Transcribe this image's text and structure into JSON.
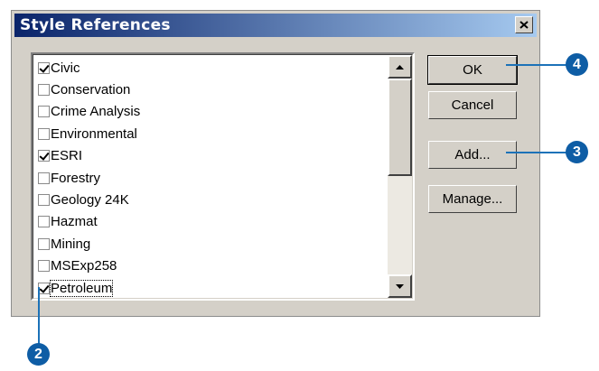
{
  "dialog": {
    "title": "Style References",
    "close_icon": "close-icon"
  },
  "style_list": {
    "items": [
      {
        "label": "Civic",
        "checked": true
      },
      {
        "label": "Conservation",
        "checked": false
      },
      {
        "label": "Crime Analysis",
        "checked": false
      },
      {
        "label": "Environmental",
        "checked": false
      },
      {
        "label": "ESRI",
        "checked": true
      },
      {
        "label": "Forestry",
        "checked": false
      },
      {
        "label": "Geology 24K",
        "checked": false
      },
      {
        "label": "Hazmat",
        "checked": false
      },
      {
        "label": "Mining",
        "checked": false
      },
      {
        "label": "MSExp258",
        "checked": false
      },
      {
        "label": "Petroleum",
        "checked": true,
        "focused": true
      }
    ]
  },
  "buttons": {
    "ok": "OK",
    "cancel": "Cancel",
    "add": "Add...",
    "manage": "Manage..."
  },
  "callouts": {
    "ok": "4",
    "add": "3",
    "checkbox": "2"
  },
  "colors": {
    "callout": "#0e5da5",
    "title_bar_start": "#0a246a",
    "title_bar_end": "#a6caf0"
  }
}
